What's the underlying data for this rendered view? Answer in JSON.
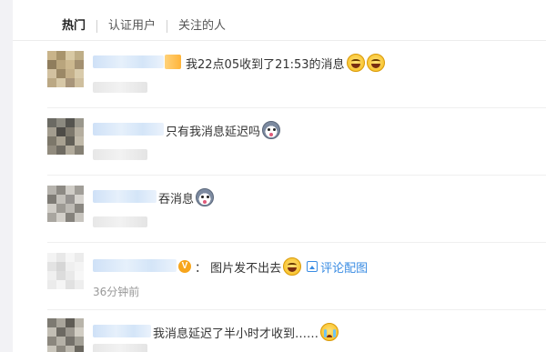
{
  "tabs": [
    {
      "label": "热门",
      "active": true
    },
    {
      "label": "认证用户",
      "active": false
    },
    {
      "label": "关注的人",
      "active": false
    }
  ],
  "comments": [
    {
      "text": "我22点05收到了21:53的消息",
      "emoji": [
        "laugh-emoji",
        "laugh-emoji"
      ],
      "time": ""
    },
    {
      "text": "只有我消息延迟吗",
      "emoji": [
        "husky-emoji"
      ],
      "time": ""
    },
    {
      "text": "吞消息",
      "emoji": [
        "husky-emoji"
      ],
      "time": ""
    },
    {
      "text": "：  图片发不出去",
      "emoji": [
        "laugh-emoji"
      ],
      "link": "评论配图",
      "time": "36分钟前"
    },
    {
      "text": "我消息延迟了半小时才收到……",
      "emoji": [
        "cry-emoji"
      ],
      "time": ""
    }
  ],
  "colors": {
    "link": "#3a8ce3",
    "verified_badge": "#f7a51c",
    "time": "#999999"
  },
  "icons": {
    "verified": "verified-v-badge-icon",
    "image": "image-icon"
  }
}
